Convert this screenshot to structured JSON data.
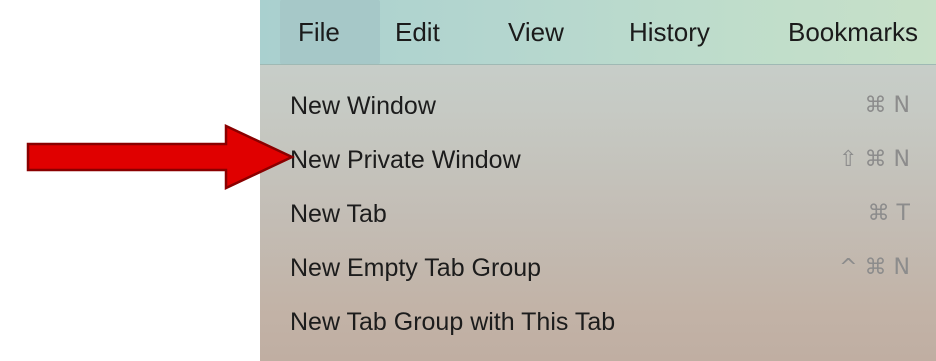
{
  "menubar": {
    "items": [
      {
        "label": "File"
      },
      {
        "label": "Edit"
      },
      {
        "label": "View"
      },
      {
        "label": "History"
      },
      {
        "label": "Bookmarks"
      }
    ]
  },
  "file_menu": {
    "items": [
      {
        "label": "New Window",
        "shortcut": "⌘ N"
      },
      {
        "label": "New Private Window",
        "shortcut": "⇧ ⌘ N"
      },
      {
        "label": "New Tab",
        "shortcut": "⌘ T"
      },
      {
        "label": "New Empty Tab Group",
        "shortcut": "^ ⌘ N"
      },
      {
        "label": "New Tab Group with This Tab",
        "shortcut": ""
      }
    ]
  },
  "annotation": {
    "arrow_color": "#e00000",
    "arrow_border": "#8a0000",
    "points_to": "New Private Window"
  }
}
